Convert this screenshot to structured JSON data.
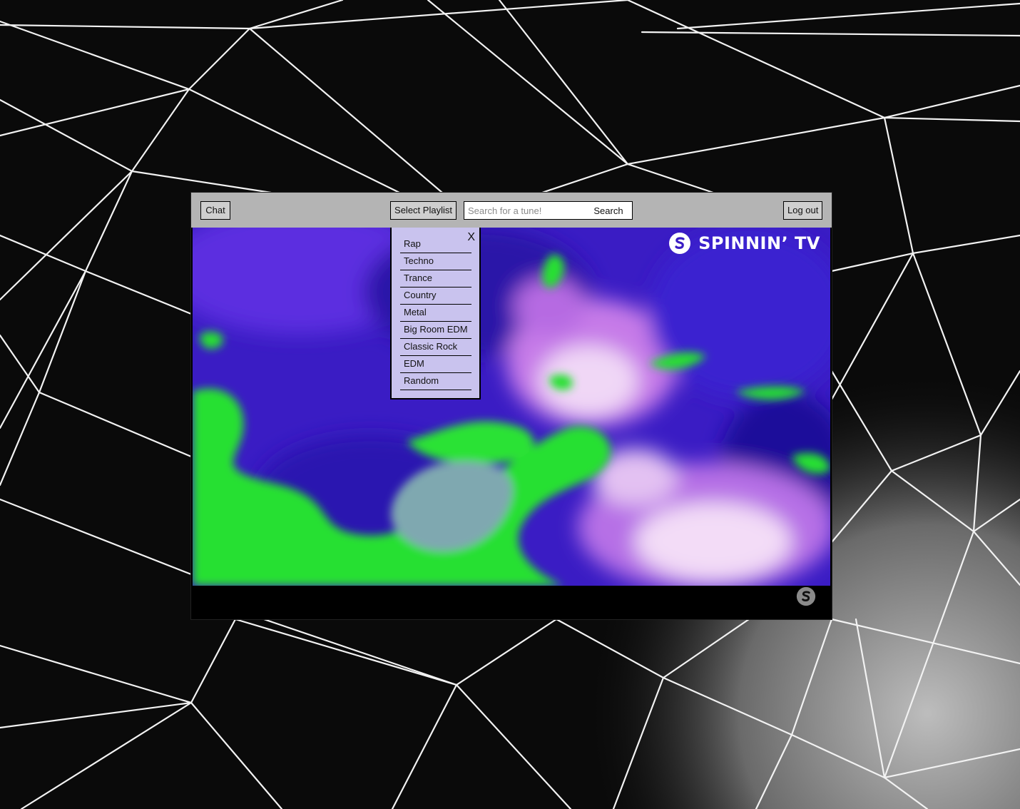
{
  "topbar": {
    "chat_label": "Chat",
    "select_playlist_label": "Select Playlist",
    "search_placeholder": "Search for a tune!",
    "search_value": "",
    "search_button_label": "Search",
    "logout_label": "Log out"
  },
  "playlist_dropdown": {
    "close_label": "X",
    "items": [
      "Rap",
      "Techno",
      "Trance",
      "Country",
      "Metal",
      "Big Room EDM",
      "Classic Rock",
      "EDM",
      "Random"
    ]
  },
  "video": {
    "channel_logo_text": "SPINNIN’ TV",
    "logo_icon": "spinnin-s-icon",
    "watermark_icon": "spinnin-s-icon"
  },
  "colors": {
    "topbar": "#b4b4b4",
    "dropdown_bg": "#c9c3ee",
    "video_purple": "#3d18c8",
    "video_green": "#22e02a"
  }
}
